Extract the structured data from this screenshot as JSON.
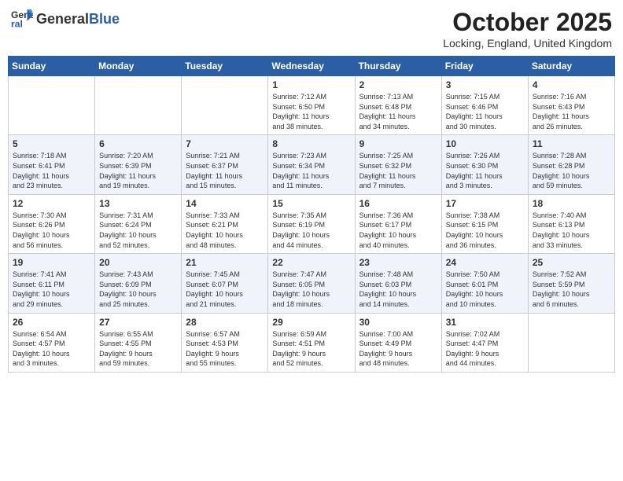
{
  "header": {
    "logo_general": "General",
    "logo_blue": "Blue",
    "month_title": "October 2025",
    "location": "Locking, England, United Kingdom"
  },
  "weekdays": [
    "Sunday",
    "Monday",
    "Tuesday",
    "Wednesday",
    "Thursday",
    "Friday",
    "Saturday"
  ],
  "weeks": [
    [
      {
        "day": "",
        "info": ""
      },
      {
        "day": "",
        "info": ""
      },
      {
        "day": "",
        "info": ""
      },
      {
        "day": "1",
        "info": "Sunrise: 7:12 AM\nSunset: 6:50 PM\nDaylight: 11 hours\nand 38 minutes."
      },
      {
        "day": "2",
        "info": "Sunrise: 7:13 AM\nSunset: 6:48 PM\nDaylight: 11 hours\nand 34 minutes."
      },
      {
        "day": "3",
        "info": "Sunrise: 7:15 AM\nSunset: 6:46 PM\nDaylight: 11 hours\nand 30 minutes."
      },
      {
        "day": "4",
        "info": "Sunrise: 7:16 AM\nSunset: 6:43 PM\nDaylight: 11 hours\nand 26 minutes."
      }
    ],
    [
      {
        "day": "5",
        "info": "Sunrise: 7:18 AM\nSunset: 6:41 PM\nDaylight: 11 hours\nand 23 minutes."
      },
      {
        "day": "6",
        "info": "Sunrise: 7:20 AM\nSunset: 6:39 PM\nDaylight: 11 hours\nand 19 minutes."
      },
      {
        "day": "7",
        "info": "Sunrise: 7:21 AM\nSunset: 6:37 PM\nDaylight: 11 hours\nand 15 minutes."
      },
      {
        "day": "8",
        "info": "Sunrise: 7:23 AM\nSunset: 6:34 PM\nDaylight: 11 hours\nand 11 minutes."
      },
      {
        "day": "9",
        "info": "Sunrise: 7:25 AM\nSunset: 6:32 PM\nDaylight: 11 hours\nand 7 minutes."
      },
      {
        "day": "10",
        "info": "Sunrise: 7:26 AM\nSunset: 6:30 PM\nDaylight: 11 hours\nand 3 minutes."
      },
      {
        "day": "11",
        "info": "Sunrise: 7:28 AM\nSunset: 6:28 PM\nDaylight: 10 hours\nand 59 minutes."
      }
    ],
    [
      {
        "day": "12",
        "info": "Sunrise: 7:30 AM\nSunset: 6:26 PM\nDaylight: 10 hours\nand 56 minutes."
      },
      {
        "day": "13",
        "info": "Sunrise: 7:31 AM\nSunset: 6:24 PM\nDaylight: 10 hours\nand 52 minutes."
      },
      {
        "day": "14",
        "info": "Sunrise: 7:33 AM\nSunset: 6:21 PM\nDaylight: 10 hours\nand 48 minutes."
      },
      {
        "day": "15",
        "info": "Sunrise: 7:35 AM\nSunset: 6:19 PM\nDaylight: 10 hours\nand 44 minutes."
      },
      {
        "day": "16",
        "info": "Sunrise: 7:36 AM\nSunset: 6:17 PM\nDaylight: 10 hours\nand 40 minutes."
      },
      {
        "day": "17",
        "info": "Sunrise: 7:38 AM\nSunset: 6:15 PM\nDaylight: 10 hours\nand 36 minutes."
      },
      {
        "day": "18",
        "info": "Sunrise: 7:40 AM\nSunset: 6:13 PM\nDaylight: 10 hours\nand 33 minutes."
      }
    ],
    [
      {
        "day": "19",
        "info": "Sunrise: 7:41 AM\nSunset: 6:11 PM\nDaylight: 10 hours\nand 29 minutes."
      },
      {
        "day": "20",
        "info": "Sunrise: 7:43 AM\nSunset: 6:09 PM\nDaylight: 10 hours\nand 25 minutes."
      },
      {
        "day": "21",
        "info": "Sunrise: 7:45 AM\nSunset: 6:07 PM\nDaylight: 10 hours\nand 21 minutes."
      },
      {
        "day": "22",
        "info": "Sunrise: 7:47 AM\nSunset: 6:05 PM\nDaylight: 10 hours\nand 18 minutes."
      },
      {
        "day": "23",
        "info": "Sunrise: 7:48 AM\nSunset: 6:03 PM\nDaylight: 10 hours\nand 14 minutes."
      },
      {
        "day": "24",
        "info": "Sunrise: 7:50 AM\nSunset: 6:01 PM\nDaylight: 10 hours\nand 10 minutes."
      },
      {
        "day": "25",
        "info": "Sunrise: 7:52 AM\nSunset: 5:59 PM\nDaylight: 10 hours\nand 6 minutes."
      }
    ],
    [
      {
        "day": "26",
        "info": "Sunrise: 6:54 AM\nSunset: 4:57 PM\nDaylight: 10 hours\nand 3 minutes."
      },
      {
        "day": "27",
        "info": "Sunrise: 6:55 AM\nSunset: 4:55 PM\nDaylight: 9 hours\nand 59 minutes."
      },
      {
        "day": "28",
        "info": "Sunrise: 6:57 AM\nSunset: 4:53 PM\nDaylight: 9 hours\nand 55 minutes."
      },
      {
        "day": "29",
        "info": "Sunrise: 6:59 AM\nSunset: 4:51 PM\nDaylight: 9 hours\nand 52 minutes."
      },
      {
        "day": "30",
        "info": "Sunrise: 7:00 AM\nSunset: 4:49 PM\nDaylight: 9 hours\nand 48 minutes."
      },
      {
        "day": "31",
        "info": "Sunrise: 7:02 AM\nSunset: 4:47 PM\nDaylight: 9 hours\nand 44 minutes."
      },
      {
        "day": "",
        "info": ""
      }
    ]
  ]
}
